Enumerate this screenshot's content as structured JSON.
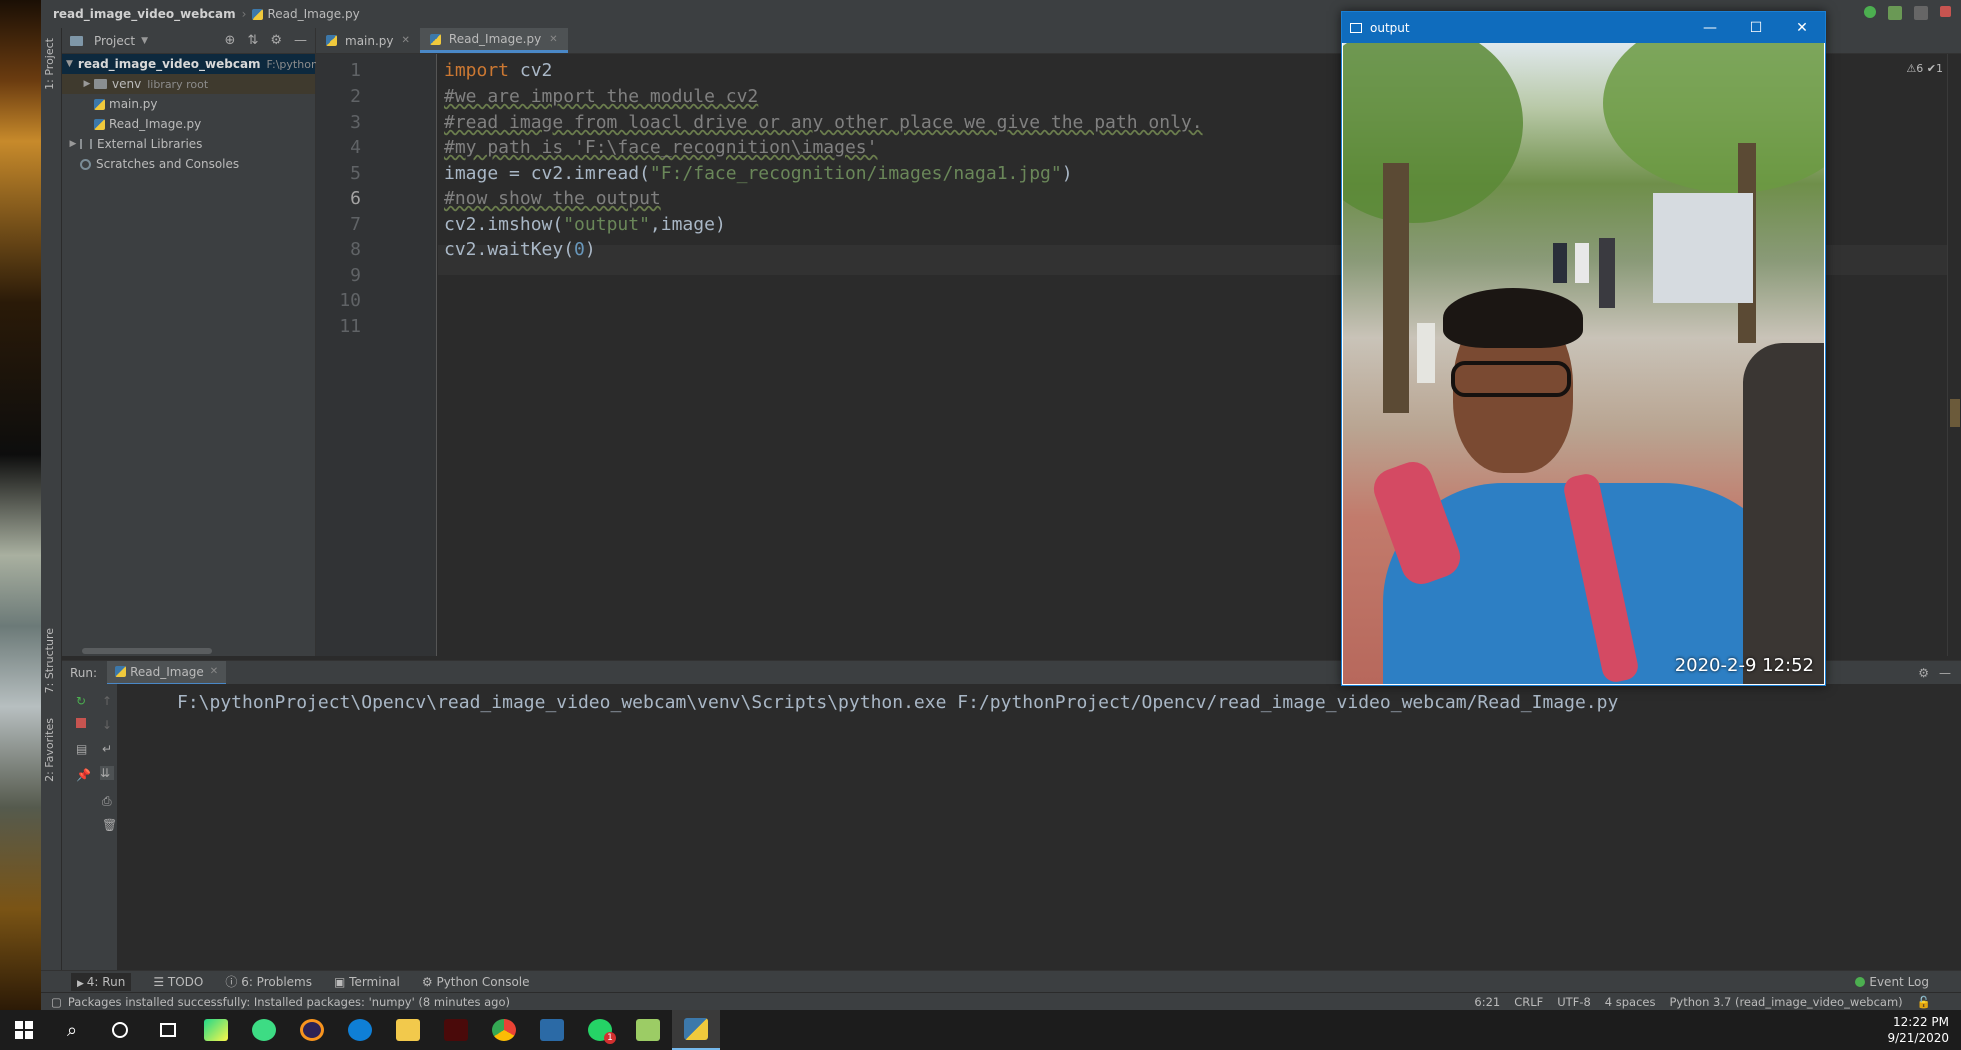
{
  "navbar": {
    "project": "read_image_video_webcam",
    "file": "Read_Image.py"
  },
  "left_stripe": {
    "project_label": "1: Project",
    "structure_label": "7: Structure",
    "favorites_label": "2: Favorites"
  },
  "project_panel": {
    "title": "Project",
    "root": {
      "name": "read_image_video_webcam",
      "path": "F:\\pythonI"
    },
    "venv": {
      "name": "venv",
      "hint": "library root"
    },
    "files": [
      "main.py",
      "Read_Image.py"
    ],
    "external": "External Libraries",
    "scratches": "Scratches and Consoles"
  },
  "editor": {
    "tabs": [
      "main.py",
      "Read_Image.py"
    ],
    "line_numbers": [
      "1",
      "2",
      "3",
      "4",
      "5",
      "6",
      "7",
      "8",
      "9",
      "10",
      "11"
    ],
    "lines": {
      "l1_kw": "import",
      "l1_rest": " cv2",
      "l2": "#we are import the module cv2",
      "l3": "#read image from loacl drive or any other place we give the path only.",
      "l4": "#my path is 'F:\\face_recognition\\images'",
      "l5_a": "image = cv2.imread(",
      "l5_str": "\"F:/face_recognition/images/naga1.jpg\"",
      "l5_b": ")",
      "l6": "#now show the output",
      "l7_a": "cv2.imshow(",
      "l7_str": "\"output\"",
      "l7_b": ",image)",
      "l8_a": "cv2.waitKey(",
      "l8_num": "0",
      "l8_b": ")"
    },
    "inspections": "⚠6 ✔1"
  },
  "output_window": {
    "title": "output",
    "timestamp": "2020-2-9 12:52"
  },
  "run_panel": {
    "label": "Run:",
    "tab": "Read_Image",
    "console_line": "F:\\pythonProject\\Opencv\\read_image_video_webcam\\venv\\Scripts\\python.exe F:/pythonProject/Opencv/read_image_video_webcam/Read_Image.py"
  },
  "bottom_tabs": {
    "run": "4: Run",
    "todo": "TODO",
    "problems": "6: Problems",
    "terminal": "Terminal",
    "python_console": "Python Console",
    "event_log": "Event Log"
  },
  "status": {
    "message": "Packages installed successfully: Installed packages: 'numpy' (8 minutes ago)",
    "position": "6:21",
    "line_sep": "CRLF",
    "encoding": "UTF-8",
    "indent": "4 spaces",
    "interpreter": "Python 3.7 (read_image_video_webcam)"
  },
  "taskbar": {
    "time": "12:22 PM",
    "date": "9/21/2020",
    "whatsapp_badge": "1"
  },
  "colors": {
    "ide_bg": "#2b2b2b",
    "panel": "#3c3f41",
    "accent": "#4a88c7",
    "keyword": "#cc7832",
    "string": "#6a8759",
    "comment": "#808080"
  }
}
